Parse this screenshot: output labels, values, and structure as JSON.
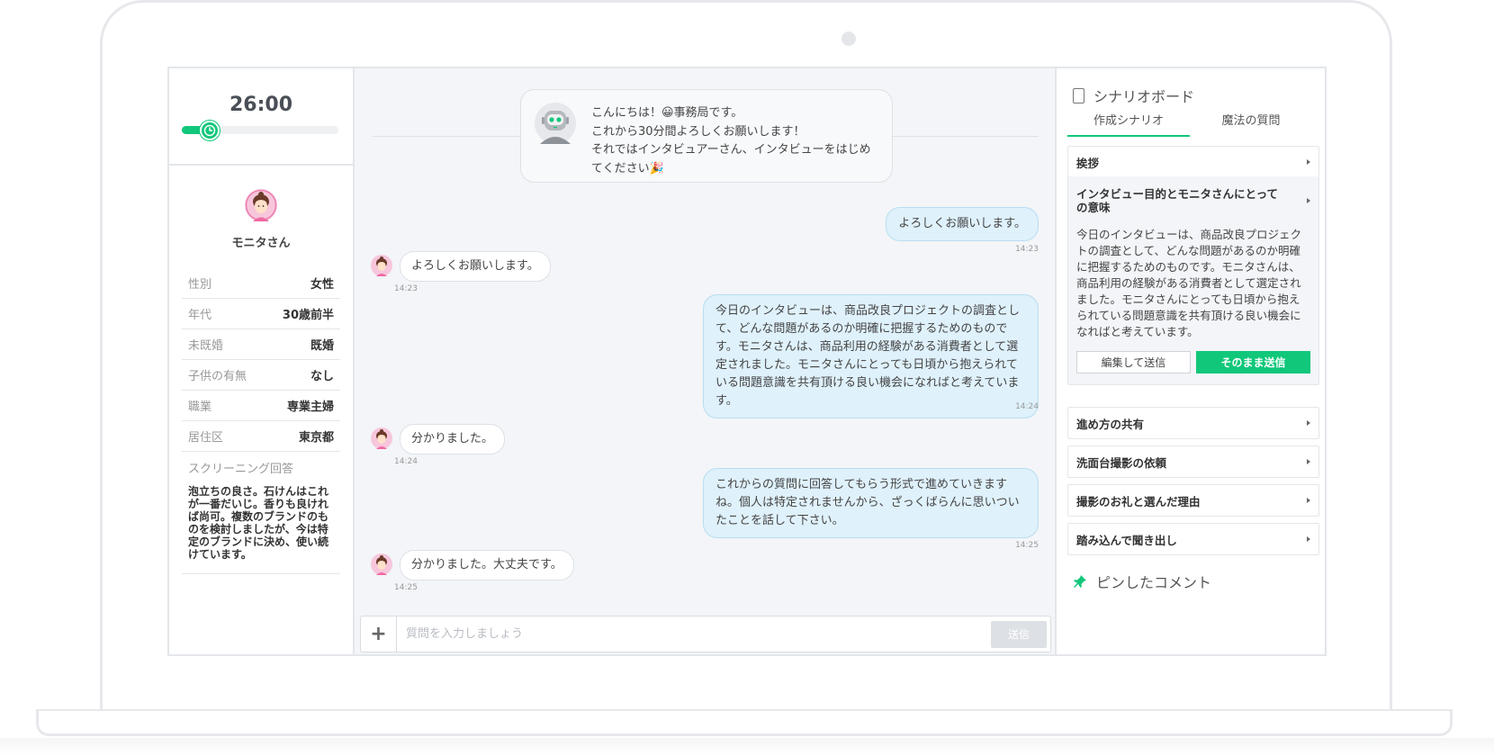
{
  "timer": {
    "label": "26:00",
    "progress_percent": 18
  },
  "profile": {
    "name": "モニタさん",
    "attributes": [
      {
        "label": "性別",
        "value": "女性"
      },
      {
        "label": "年代",
        "value": "30歳前半"
      },
      {
        "label": "未既婚",
        "value": "既婚"
      },
      {
        "label": "子供の有無",
        "value": "なし"
      },
      {
        "label": "職業",
        "value": "専業主婦"
      },
      {
        "label": "居住区",
        "value": "東京都"
      }
    ],
    "screening_label": "スクリーニング回答",
    "screening_text": "泡立ちの良さ。石けんはこれが一番だいじ。香りも良ければ尚可。複数のブランドのものを検討しましたが、今は特定のブランドに決め、使い続けています。"
  },
  "chat": {
    "system_lines": [
      "こんにちは！😀事務局です。",
      "これから30分間よろしくお願いします！",
      "それではインタビュアーさん、インタビューをはじめてください🎉"
    ],
    "messages": [
      {
        "from": "me",
        "text": "よろしくお願いします。",
        "time": "14:23"
      },
      {
        "from": "them",
        "text": "よろしくお願いします。",
        "time": "14:23"
      },
      {
        "from": "me",
        "text": "今日のインタビューは、商品改良プロジェクトの調査として、どんな問題があるのか明確に把握するためのものです。モニタさんは、商品利用の経験がある消費者として選定されました。モニタさんにとっても日頃から抱えられている問題意識を共有頂ける良い機会になればと考えています。",
        "time": "14:24"
      },
      {
        "from": "them",
        "text": "分かりました。",
        "time": "14:24"
      },
      {
        "from": "me",
        "text": "これからの質問に回答してもらう形式で進めていきますね。個人は特定されませんから、ざっくばらんに思いついたことを話して下さい。",
        "time": "14:25"
      },
      {
        "from": "them",
        "text": "分かりました。大丈夫です。",
        "time": "14:25"
      }
    ],
    "input_placeholder": "質問を入力しましょう",
    "send_label": "送信",
    "plus_label": "+"
  },
  "board": {
    "title": "シナリオボード",
    "tabs": [
      "作成シナリオ",
      "魔法の質問"
    ],
    "active_tab": 0,
    "sections": [
      {
        "title": "挨拶"
      },
      {
        "title": "インタビュー目的とモニタさんにとっての意味",
        "body": "今日のインタビューは、商品改良プロジェクトの調査として、どんな問題があるのか明確に把握するためのものです。モニタさんは、商品利用の経験がある消費者として選定されました。モニタさんにとっても日頃から抱えられている問題意識を共有頂ける良い機会になればと考えています。"
      },
      {
        "title": "進め方の共有"
      },
      {
        "title": "洗面台撮影の依頼"
      },
      {
        "title": "撮影のお礼と選んだ理由"
      },
      {
        "title": "踏み込んで聞き出し"
      }
    ],
    "edit_send_label": "編集して送信",
    "send_as_is_label": "そのまま送信",
    "pinned_title": "ピンしたコメント"
  },
  "colors": {
    "accent": "#10c77a",
    "my_bubble": "#dff1fb",
    "chat_bg": "#f3f5f8"
  },
  "icons": [
    "clock-icon",
    "avatar",
    "bot-avatar",
    "plus-icon",
    "document-icon",
    "caret-right-icon",
    "pin-icon"
  ]
}
